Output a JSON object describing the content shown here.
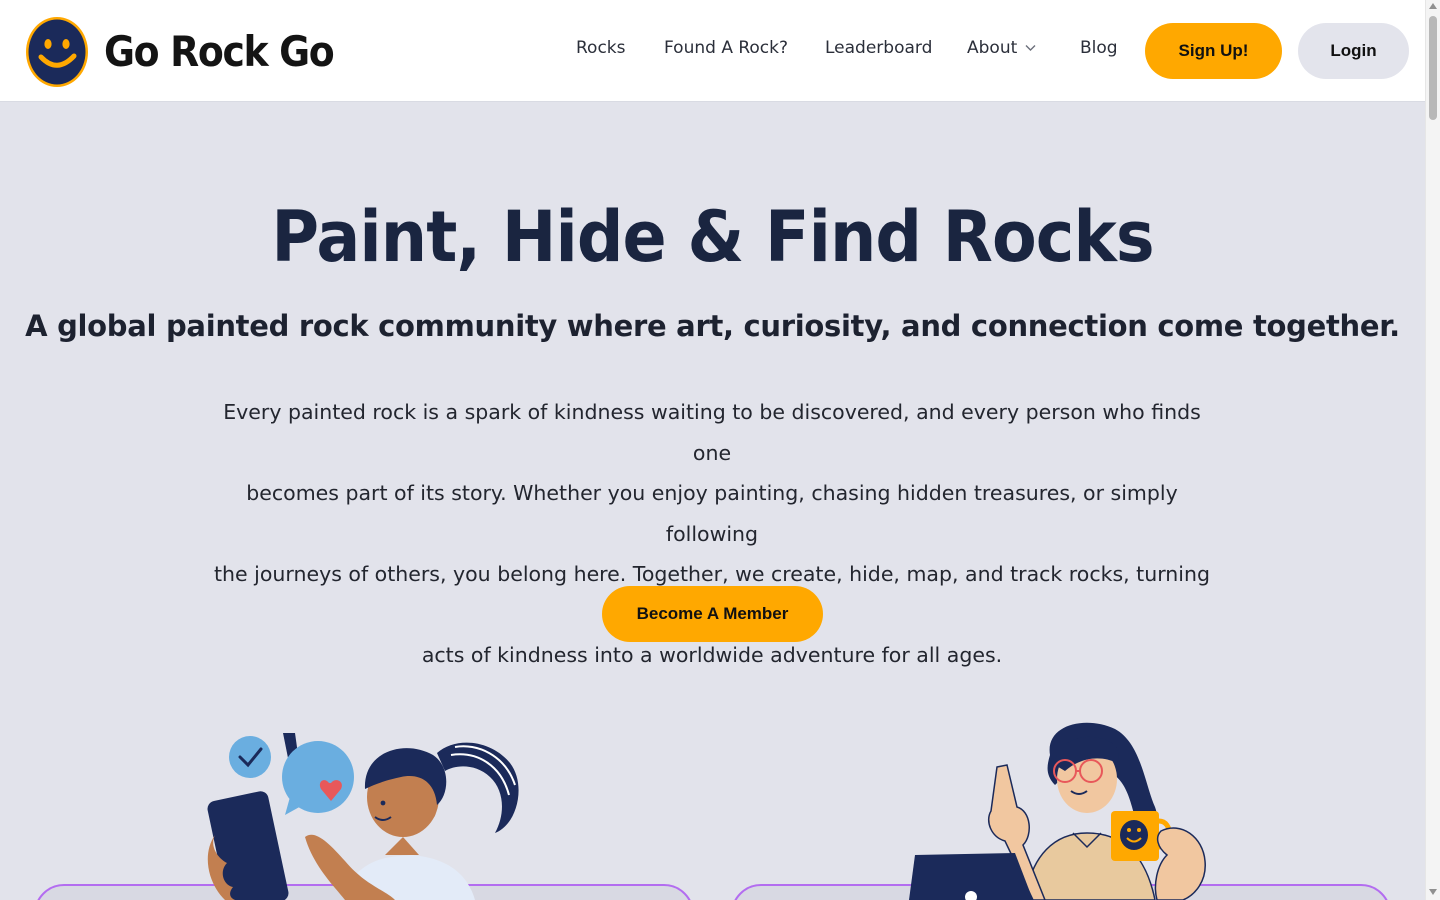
{
  "brand": {
    "name": "Go Rock Go"
  },
  "nav": {
    "items": [
      {
        "label": "Rocks"
      },
      {
        "label": "Found A Rock?"
      },
      {
        "label": "Leaderboard"
      },
      {
        "label": "About"
      },
      {
        "label": "Blog"
      }
    ],
    "signup_label": "Sign Up!",
    "login_label": "Login"
  },
  "hero": {
    "title": "Paint, Hide & Find Rocks",
    "subtitle": "A global painted rock community where art, curiosity, and connection come together.",
    "body_lines": [
      "Every painted rock is a spark of kindness waiting to be discovered, and every person who finds one",
      "becomes part of its story. Whether you enjoy painting, chasing hidden treasures, or simply following",
      "the journeys of others, you belong here. Together, we create, hide, map, and track rocks, turning small",
      "acts of kindness into a worldwide adventure for all ages."
    ],
    "cta_label": "Become A Member"
  },
  "colors": {
    "accent": "#ffa800",
    "navy": "#1b2a5a",
    "background": "#e2e3eb",
    "card_border": "#b36df0"
  },
  "icons": [
    "smiley-rock-logo-icon",
    "chevron-down-icon",
    "check-icon",
    "exclamation-icon",
    "heart-icon"
  ]
}
